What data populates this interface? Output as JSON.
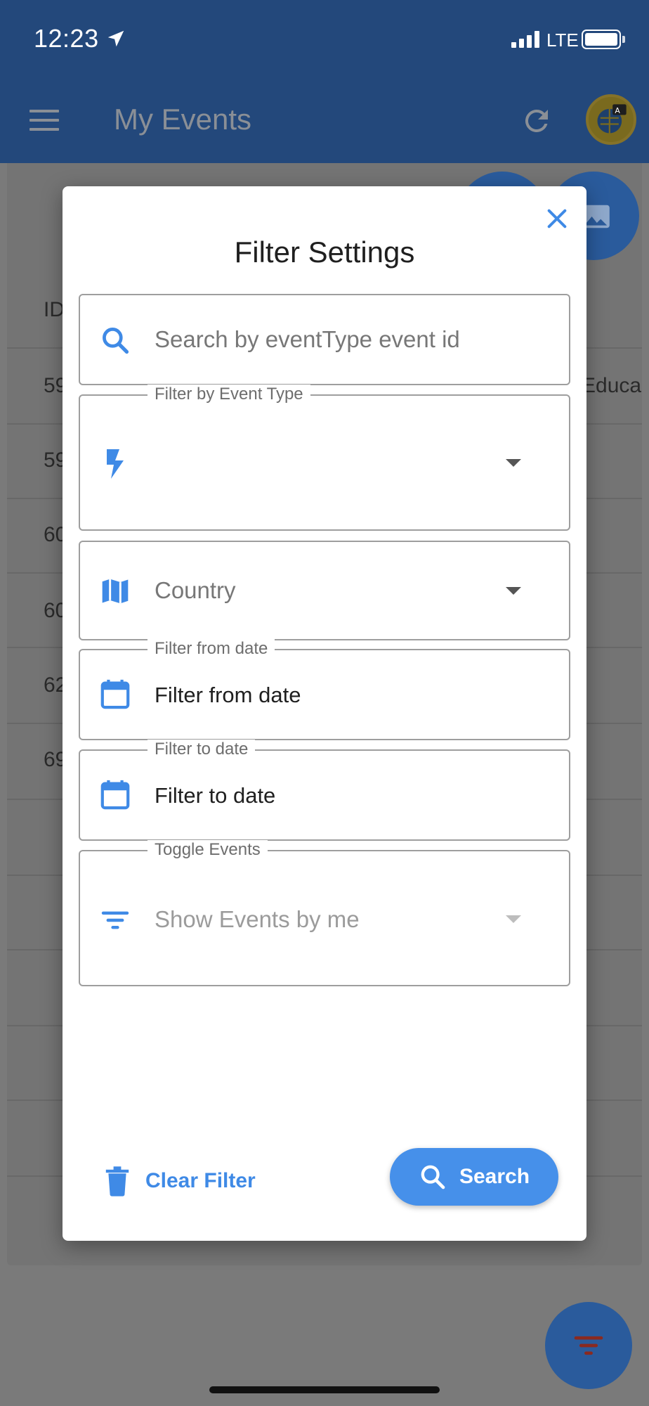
{
  "status_bar": {
    "time": "12:23",
    "network": "LTE"
  },
  "app_bar": {
    "title": "My Events",
    "icons": [
      "menu-icon",
      "refresh-icon",
      "language-globe-icon"
    ]
  },
  "background_table": {
    "header": "ID",
    "rows": [
      "59",
      "59",
      "60",
      "60",
      "62",
      "69"
    ],
    "partial_cell": "Educa"
  },
  "dialog": {
    "title": "Filter Settings",
    "search": {
      "placeholder": "Search by eventType event id",
      "icon": "search-icon"
    },
    "event_type": {
      "label": "Filter by Event Type",
      "value": "",
      "icon": "flash-icon"
    },
    "country": {
      "placeholder": "Country",
      "icon": "map-icon"
    },
    "from_date": {
      "label": "Filter from date",
      "value": "Filter from date",
      "icon": "calendar-icon"
    },
    "to_date": {
      "label": "Filter to date",
      "value": "Filter to date",
      "icon": "calendar-icon"
    },
    "toggle": {
      "label": "Toggle Events",
      "value": "Show Events by me",
      "icon": "filter-list-icon"
    },
    "clear_label": "Clear Filter",
    "search_label": "Search"
  },
  "colors": {
    "app_bar": "#23487b",
    "accent": "#4690ea",
    "overlay": "#7a7a7a"
  }
}
